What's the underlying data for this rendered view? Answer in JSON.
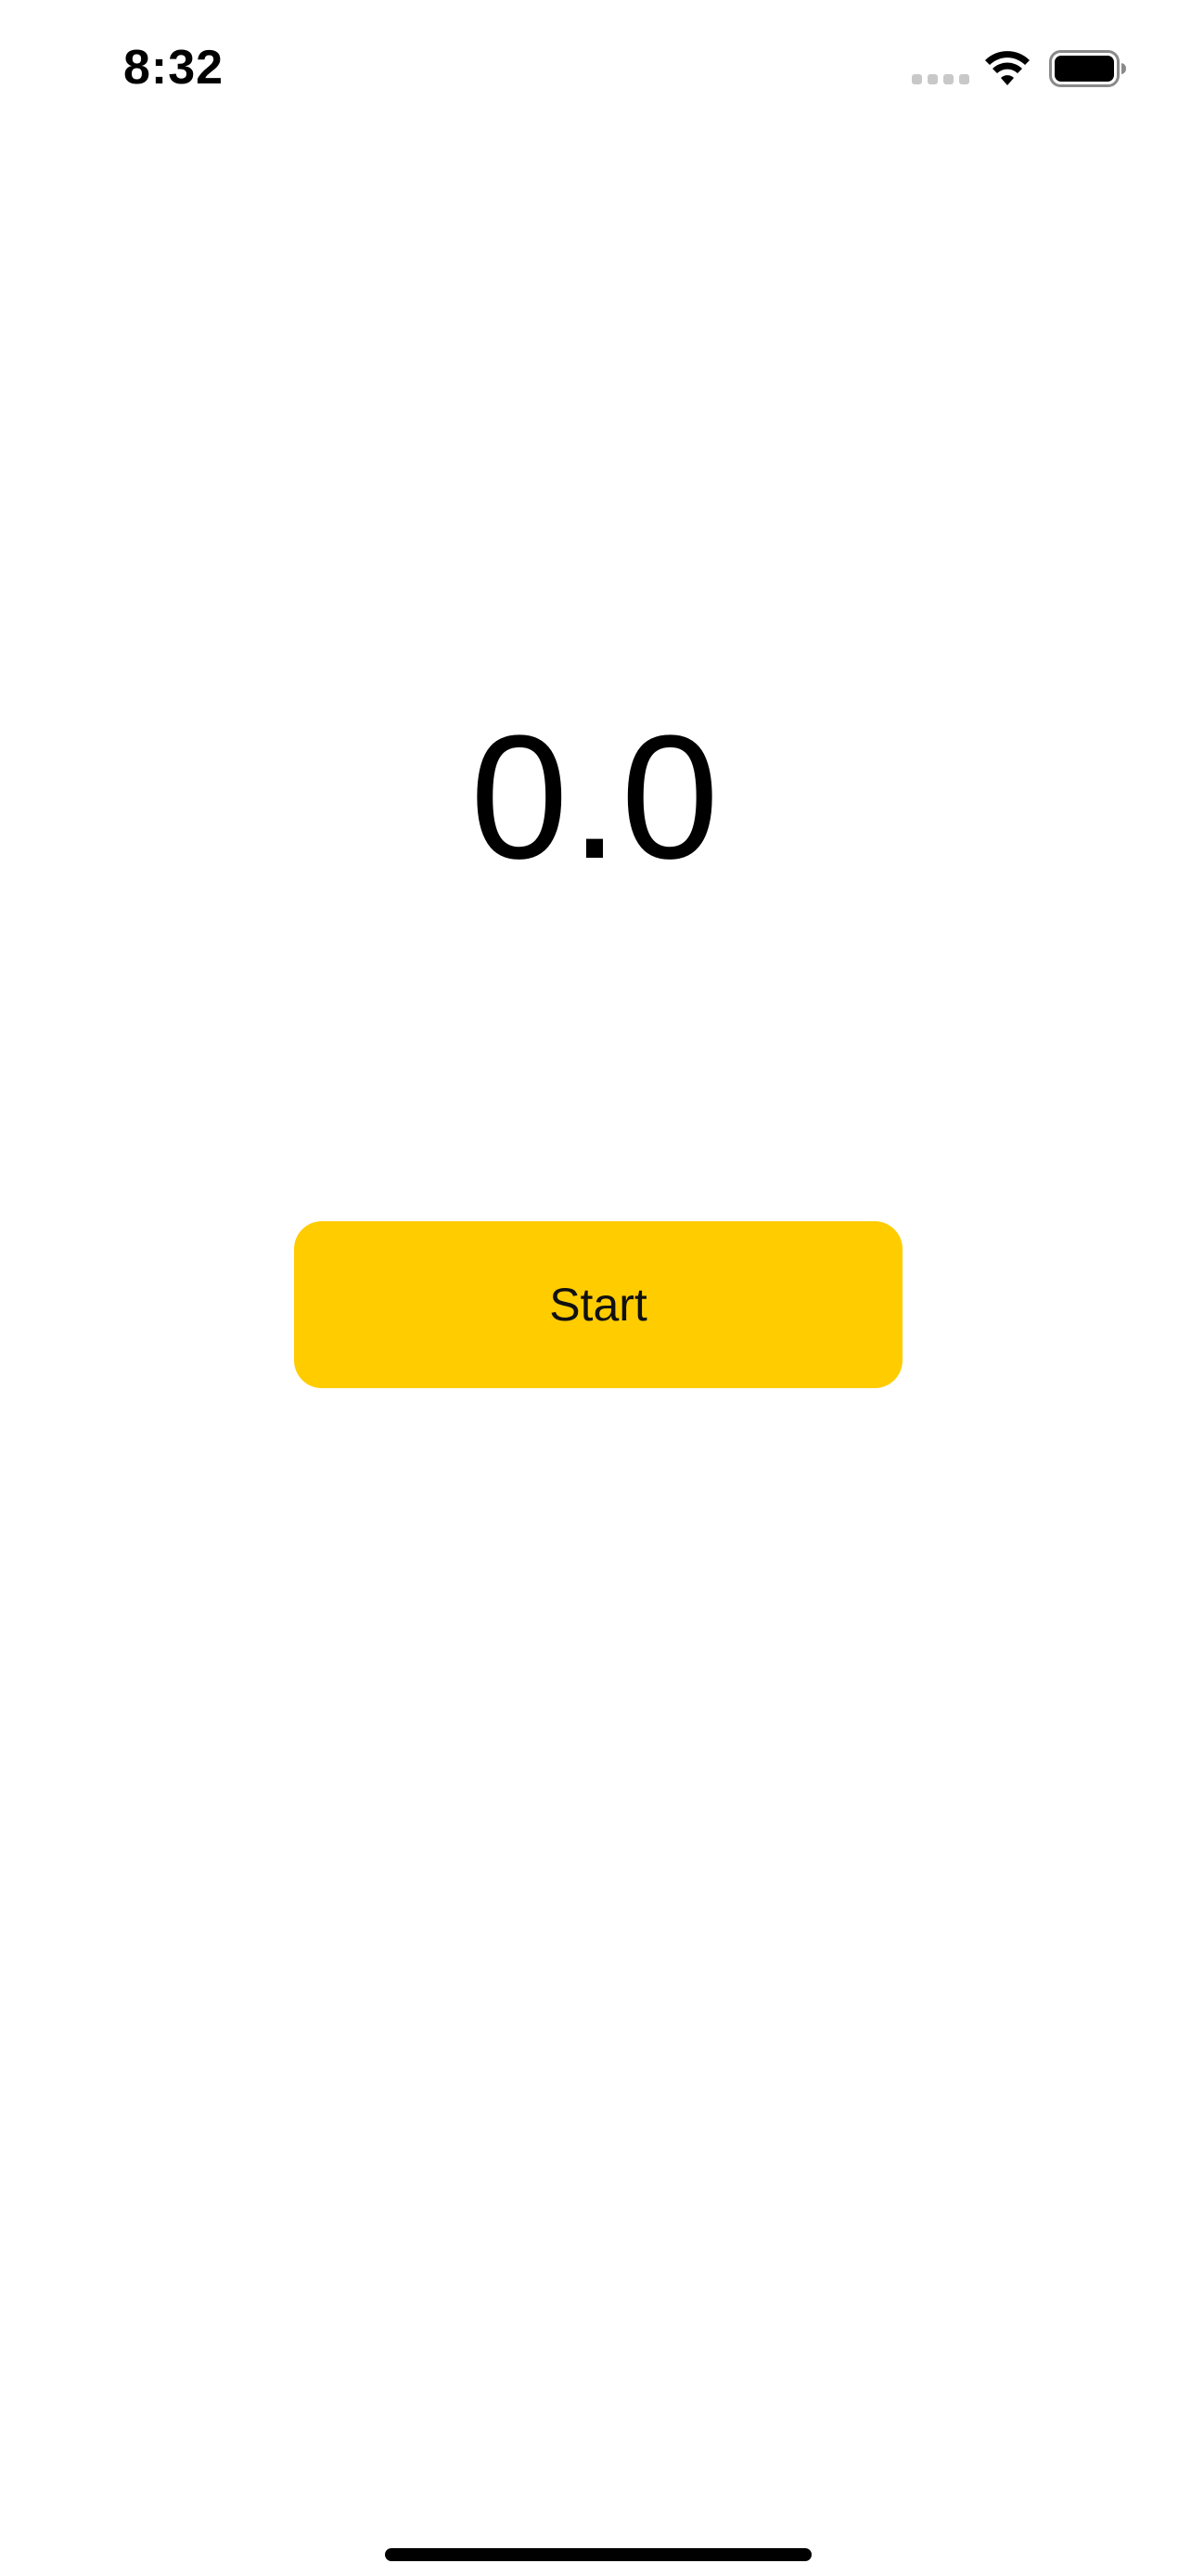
{
  "status_bar": {
    "time": "8:32",
    "icons": [
      "cellular-signal-icon",
      "wifi-icon",
      "battery-icon"
    ]
  },
  "timer": {
    "value": "0.0"
  },
  "actions": {
    "start_label": "Start"
  },
  "colors": {
    "accent": "#ffcc00",
    "background": "#ffffff",
    "text": "#000000"
  }
}
